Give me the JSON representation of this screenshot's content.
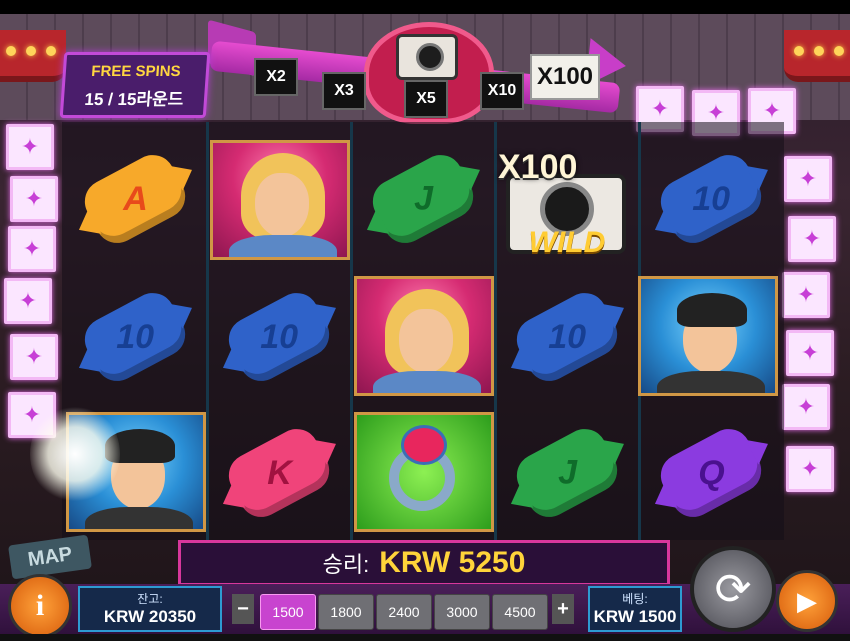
{
  "free_spins": {
    "title": "FREE SPINS",
    "count": "15 / 15라운드"
  },
  "multipliers": [
    "X2",
    "X3",
    "X5",
    "X10",
    "X100"
  ],
  "reels": {
    "wild": {
      "multiplier": "X100",
      "label": "WILD"
    },
    "symbols": {
      "r1c1": "A",
      "r1c2": "woman-portrait",
      "r1c3": "J",
      "r1c4": "wild",
      "r1c5": "10",
      "r2c1": "10",
      "r2c2": "10",
      "r2c3": "woman-portrait",
      "r2c4": "10",
      "r2c5": "man-portrait",
      "r3c1": "man-portrait",
      "r3c2": "K",
      "r3c3": "ring",
      "r3c4": "J",
      "r3c5": "Q"
    }
  },
  "side_label": "MAP",
  "win": {
    "label": "승리:",
    "value": "KRW 5250"
  },
  "balance": {
    "label": "잔고:",
    "value": "KRW 20350"
  },
  "bet": {
    "label": "베팅:",
    "value": "KRW 1500"
  },
  "bet_options": [
    "1500",
    "1800",
    "2400",
    "3000",
    "4500"
  ],
  "bet_selected": "1500",
  "buttons": {
    "minus": "−",
    "plus": "+",
    "info": "i"
  },
  "colors": {
    "accent": "#c844cf",
    "win_value": "#ffd43a",
    "frame": "#d09745"
  }
}
